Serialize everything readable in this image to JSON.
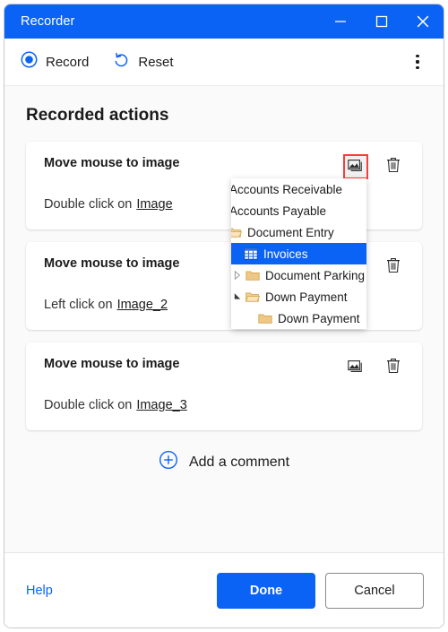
{
  "window": {
    "title": "Recorder",
    "controls": [
      {
        "name": "minimize",
        "glyph": "minimize-icon"
      },
      {
        "name": "maximize",
        "glyph": "maximize-icon"
      },
      {
        "name": "close",
        "glyph": "close-icon"
      }
    ]
  },
  "toolbar": {
    "record_label": "Record",
    "record_icon": "record-circle-icon",
    "reset_label": "Reset",
    "reset_icon": "reset-arrow-icon",
    "more_icon": "more-vertical-icon"
  },
  "main": {
    "heading": "Recorded actions",
    "cards": [
      {
        "title": "Move mouse to image",
        "action_prefix": "Double click on",
        "target": "Image",
        "image_icon": "picture-icon",
        "delete_icon": "trash-icon",
        "image_icon_highlighted": true
      },
      {
        "title": "Move mouse to image",
        "action_prefix": "Left click on",
        "target": "Image_2",
        "image_icon": "picture-icon",
        "delete_icon": "trash-icon",
        "image_icon_highlighted": false
      },
      {
        "title": "Move mouse to image",
        "action_prefix": "Double click on",
        "target": "Image_3",
        "image_icon": "picture-icon",
        "delete_icon": "trash-icon",
        "image_icon_highlighted": false
      }
    ],
    "add_comment": {
      "label": "Add a comment",
      "icon": "plus-circle-icon"
    }
  },
  "tree_popup": {
    "rows": [
      {
        "label": "Accounts Receivable",
        "indent": 0,
        "arrow": "none",
        "icon": "none",
        "selected": false,
        "clipped": true
      },
      {
        "label": "Accounts Payable",
        "indent": 0,
        "arrow": "none",
        "icon": "none",
        "selected": false,
        "clipped": true
      },
      {
        "label": "Document Entry",
        "indent": 0,
        "arrow": "none",
        "icon": "folder-open-icon",
        "selected": false,
        "clipped": true
      },
      {
        "label": "Invoices",
        "indent": 1,
        "arrow": "none",
        "icon": "grid-table-icon",
        "selected": true,
        "clipped": false
      },
      {
        "label": "Document Parking",
        "indent": 0,
        "arrow": "collapsed",
        "icon": "folder-closed-icon",
        "selected": false,
        "clipped": false
      },
      {
        "label": "Down Payment",
        "indent": 0,
        "arrow": "expanded",
        "icon": "folder-open-icon",
        "selected": false,
        "clipped": false
      },
      {
        "label": "Down Payment",
        "indent": 2,
        "arrow": "none",
        "icon": "folder-closed-icon",
        "selected": false,
        "clipped": false
      }
    ]
  },
  "footer": {
    "help_label": "Help",
    "done_label": "Done",
    "cancel_label": "Cancel"
  },
  "colors": {
    "accent": "#0b63f6",
    "highlight_border": "#fa3c3c",
    "folder": "#e6b566",
    "background": "#fafafa"
  }
}
